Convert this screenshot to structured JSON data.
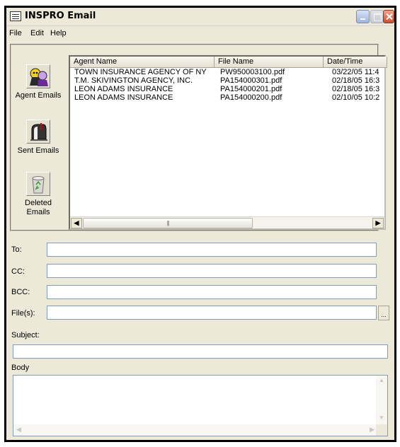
{
  "window": {
    "title": "INSPRO Email"
  },
  "menu": [
    "File",
    "Edit",
    "Help"
  ],
  "folders": [
    {
      "label": "Agent Emails",
      "icon": "agent-emails-icon"
    },
    {
      "label": "Sent Emails",
      "icon": "mailbox-icon"
    },
    {
      "label": "Deleted Emails",
      "icon": "recycle-bin-icon"
    }
  ],
  "email_list": {
    "columns": [
      "Agent Name",
      "File Name",
      "Date/Time"
    ],
    "rows": [
      [
        "TOWN INSURANCE AGENCY OF NY",
        "PW950003100.pdf",
        "03/22/05 11:4"
      ],
      [
        "T.M. SKIVINGTON AGENCY, INC.",
        "PA154000301.pdf",
        "02/18/05 16:3"
      ],
      [
        "LEON ADAMS INSURANCE",
        "PA154000201.pdf",
        "02/18/05 16:3"
      ],
      [
        "LEON ADAMS INSURANCE",
        "PA154000200.pdf",
        "02/10/05 10:2"
      ]
    ]
  },
  "form": {
    "to_label": "To:",
    "cc_label": "CC:",
    "bcc_label": "BCC:",
    "files_label": "File(s):",
    "subject_label": "Subject:",
    "body_label": "Body",
    "browse_label": "...",
    "to_value": "",
    "cc_value": "",
    "bcc_value": "",
    "files_value": "",
    "subject_value": "",
    "body_value": ""
  }
}
